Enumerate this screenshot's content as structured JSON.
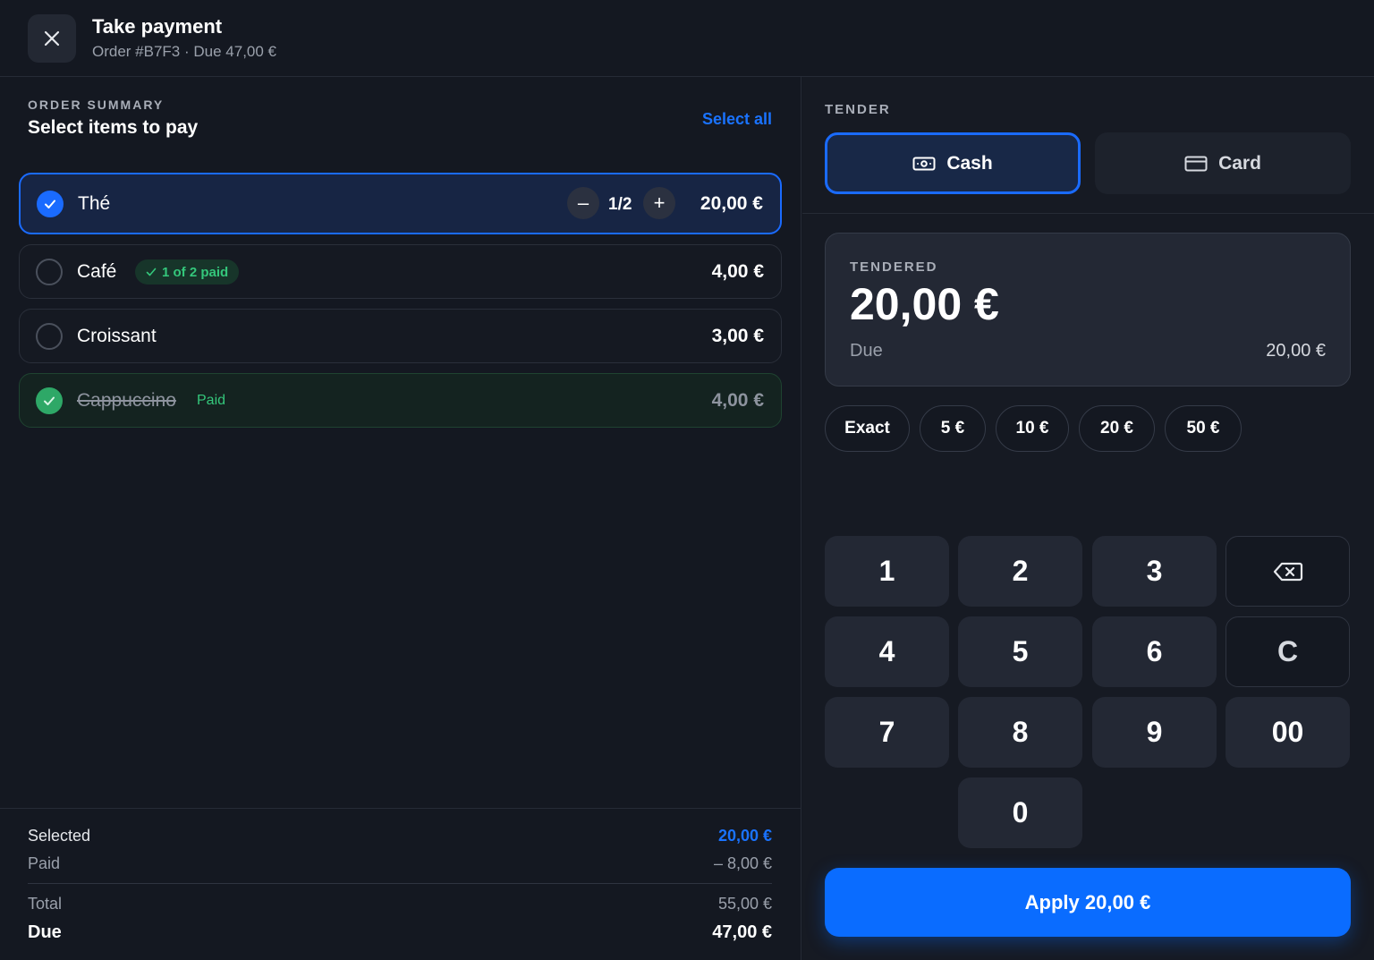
{
  "header": {
    "title": "Take payment",
    "subtitle": "Order #B7F3 · Due 47,00 €"
  },
  "order": {
    "eyebrow": "ORDER SUMMARY",
    "title": "Select items to pay",
    "select_all": "Select all",
    "items": [
      {
        "name": "Thé",
        "price": "20,00 €",
        "state": "selected",
        "quantity": "1/2",
        "minus": "–",
        "plus": "+"
      },
      {
        "name": "Café",
        "price": "4,00 €",
        "state": "unselected",
        "badge": "1 of 2 paid"
      },
      {
        "name": "Croissant",
        "price": "3,00 €",
        "state": "unselected"
      },
      {
        "name": "Cappuccino",
        "price": "4,00 €",
        "state": "paid",
        "tag": "Paid"
      }
    ]
  },
  "summary": {
    "selected_label": "Selected",
    "selected_value": "20,00 €",
    "paid_label": "Paid",
    "paid_value": "– 8,00 €",
    "total_label": "Total",
    "total_value": "55,00 €",
    "due_label": "Due",
    "due_value": "47,00 €"
  },
  "tender": {
    "eyebrow": "TENDER",
    "methods": [
      {
        "label": "Cash",
        "icon": "cash-icon",
        "active": true
      },
      {
        "label": "Card",
        "icon": "credit-card-icon",
        "active": false
      }
    ],
    "tendered_label": "TENDERED",
    "tendered_value": "20,00 €",
    "due_label": "Due",
    "due_value": "20,00 €",
    "quick_amounts": [
      "Exact",
      "5 €",
      "10 €",
      "20 €",
      "50 €"
    ],
    "keypad": [
      "1",
      "2",
      "3",
      "4",
      "5",
      "6",
      "7",
      "8",
      "9",
      "00",
      "0"
    ],
    "clear_key": "C",
    "backspace_icon": "backspace-icon",
    "apply_label": "Apply 20,00 €"
  },
  "colors": {
    "accent": "#1a6bff",
    "success": "#2ea867",
    "background": "#141821"
  }
}
